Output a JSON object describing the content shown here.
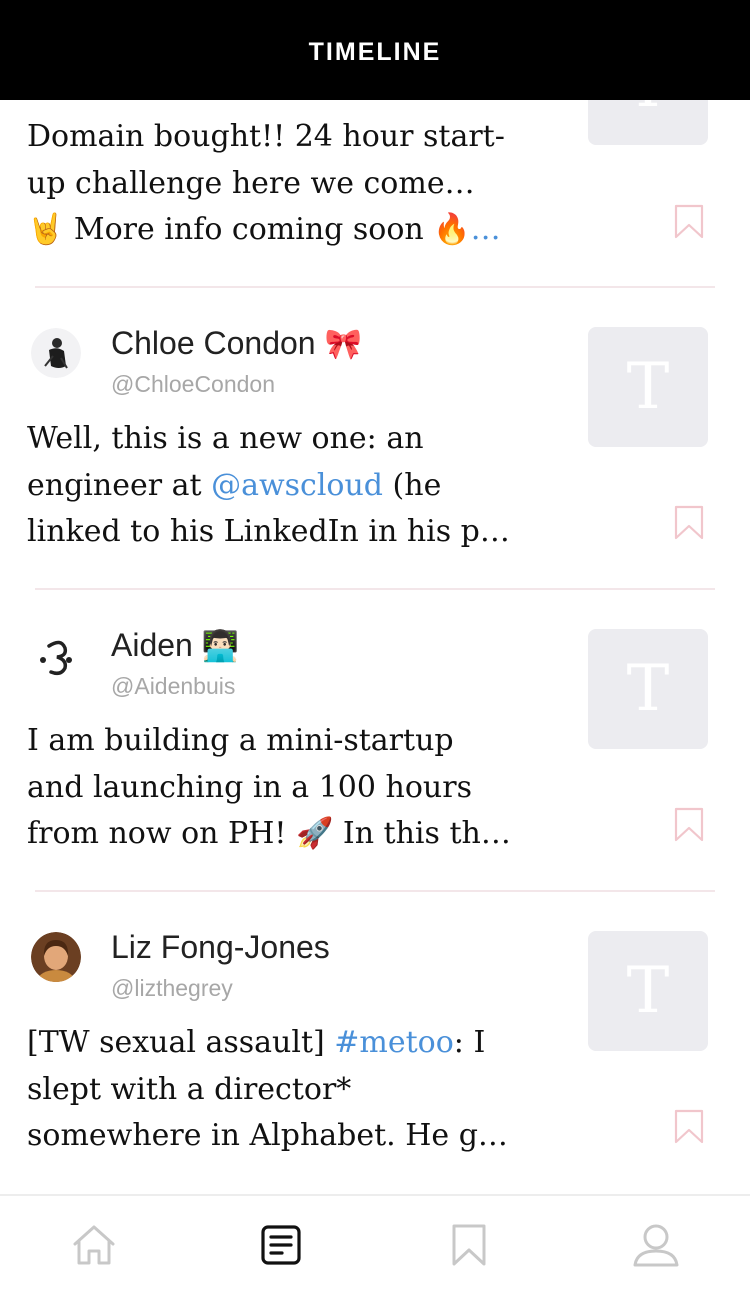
{
  "header": {
    "title": "TIMELINE"
  },
  "tweets": [
    {
      "lines": [
        "Domain bought!! 24 hour start-",
        "up challenge here we come…",
        "🤘 More info coming soon 🔥"
      ],
      "ellipsis": "…",
      "thumb_letter": "T"
    },
    {
      "name": "Chloe Condon",
      "name_emoji": "🎀",
      "handle": "@ChloeCondon",
      "line1": "Well, this is a new one: an",
      "line2_pre": "engineer at ",
      "line2_link": "@awscloud",
      "line2_post": " (he",
      "line3": "linked to his LinkedIn in his p…",
      "thumb_letter": "T"
    },
    {
      "name": "Aiden",
      "name_emoji": "👨🏻‍💻",
      "handle": "@Aidenbuis",
      "line1": "I am building a mini-startup",
      "line2": "and launching in a 100 hours",
      "line3_pre": "from now on PH! ",
      "line3_emoji": "🚀",
      "line3_post": " In this th…",
      "thumb_letter": "T"
    },
    {
      "name": "Liz Fong-Jones",
      "handle": "@lizthegrey",
      "line1_pre": "[TW sexual assault] ",
      "line1_link": "#metoo",
      "line1_post": ": I",
      "line2": "slept with a director*",
      "line3": "somewhere in Alphabet. He g…",
      "thumb_letter": "T"
    }
  ],
  "tabbar": {
    "items": [
      {
        "icon": "home-icon",
        "active": false
      },
      {
        "icon": "timeline-icon",
        "active": true
      },
      {
        "icon": "bookmark-icon",
        "active": false
      },
      {
        "icon": "profile-icon",
        "active": false
      }
    ]
  },
  "colors": {
    "link": "#4a90d9",
    "divider": "#f3e6e9",
    "bookmark": "#f1c6cc",
    "thumb": "#ececf0"
  }
}
